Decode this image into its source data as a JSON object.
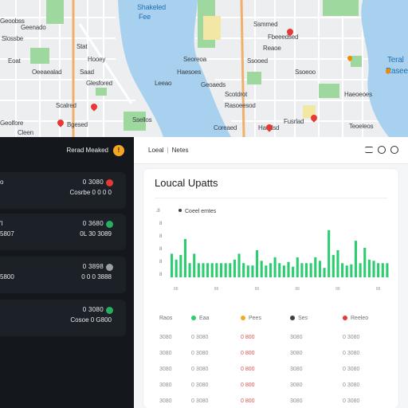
{
  "colors": {
    "water": "#a8d1f0",
    "park": "#9fd89f",
    "road_major": "#f0b06a",
    "sidebar_bg": "#14171c",
    "card_bg": "#1c2027",
    "badge": "#f5a623",
    "bar": "#2ecc71",
    "status_red": "#e53935",
    "status_green": "#27ae60"
  },
  "map": {
    "labels": [
      {
        "text": "Shakeled",
        "kind": "water"
      },
      {
        "text": "Fee",
        "kind": "water"
      },
      {
        "text": "Geenado",
        "kind": "street"
      },
      {
        "text": "Slossbe",
        "kind": "street"
      },
      {
        "text": "Stat",
        "kind": "street"
      },
      {
        "text": "Hooey",
        "kind": "street"
      },
      {
        "text": "Eoat",
        "kind": "street"
      },
      {
        "text": "Oeeaealad",
        "kind": "street"
      },
      {
        "text": "Glesfored",
        "kind": "street"
      },
      {
        "text": "Scalred",
        "kind": "street"
      },
      {
        "text": "Bgesed",
        "kind": "street"
      },
      {
        "text": "Geolfore",
        "kind": "street"
      },
      {
        "text": "Cleen",
        "kind": "street"
      },
      {
        "text": "Ssellos",
        "kind": "street"
      },
      {
        "text": "Seoreoa",
        "kind": "street"
      },
      {
        "text": "Leeao",
        "kind": "street"
      },
      {
        "text": "Haesoes",
        "kind": "street"
      },
      {
        "text": "Geoaeds",
        "kind": "street"
      },
      {
        "text": "Scotdrot",
        "kind": "street"
      },
      {
        "text": "Rasoeesod",
        "kind": "street"
      },
      {
        "text": "Coreaed",
        "kind": "street"
      },
      {
        "text": "Teral",
        "kind": "water"
      },
      {
        "text": "Rasee",
        "kind": "water"
      },
      {
        "text": "Haeoeoes",
        "kind": "street"
      },
      {
        "text": "Teoeleos",
        "kind": "street"
      },
      {
        "text": "Ssmmed",
        "kind": "street"
      },
      {
        "text": "Fbeeedsed",
        "kind": "street"
      },
      {
        "text": "Reaoe",
        "kind": "street"
      },
      {
        "text": "Ssooed",
        "kind": "street"
      },
      {
        "text": "Fusrlad",
        "kind": "street"
      },
      {
        "text": "Haedsd",
        "kind": "street"
      },
      {
        "text": "Geoobss",
        "kind": "street"
      },
      {
        "text": "Ssoeoo",
        "kind": "street"
      },
      {
        "text": "Saad",
        "kind": "street"
      }
    ]
  },
  "sidebar": {
    "title": "Rerad Meaked",
    "badge_icon": "alert-icon",
    "cards": [
      {
        "left1": "o",
        "left2": "",
        "right1": "0 3080",
        "right2": "Cosrbe 0 0 0 0",
        "dot": "#e53935"
      },
      {
        "left1": "'l",
        "left2": "5807",
        "right1": "0 3680",
        "right2": "0L 30 3089",
        "dot": "#27ae60"
      },
      {
        "left1": "",
        "left2": "5800",
        "right1": "0 3898",
        "right2": "0 0 0 3888",
        "dot": "#9aa0a6"
      },
      {
        "left1": "",
        "left2": "",
        "right1": "0 3080",
        "right2": "Cosoe 0 G800",
        "dot": "#27ae60"
      }
    ]
  },
  "main": {
    "header_title": "Loeal",
    "header_subtitle": "Netes",
    "header_icons": [
      "grid-icon",
      "info-icon",
      "settings-icon"
    ],
    "panel_title": "Loucal Upatts"
  },
  "chart_data": {
    "type": "bar",
    "legend": "Coeel emtes",
    "y_ticks": [
      "18",
      "8",
      "8",
      "8",
      "8",
      "8"
    ],
    "ylim": [
      0,
      100
    ],
    "x_ticks": [
      "88",
      "88",
      "88",
      "88",
      "88",
      "88"
    ],
    "values": [
      40,
      30,
      38,
      65,
      24,
      40,
      24,
      24,
      24,
      24,
      24,
      24,
      24,
      24,
      30,
      40,
      24,
      20,
      20,
      46,
      28,
      20,
      24,
      34,
      24,
      20,
      26,
      18,
      34,
      24,
      24,
      24,
      34,
      28,
      16,
      80,
      38,
      46,
      24,
      20,
      22,
      62,
      24,
      50,
      30,
      28,
      24,
      24,
      24
    ]
  },
  "table": {
    "headers": [
      {
        "text": "Raos",
        "dot": ""
      },
      {
        "text": "Eaa",
        "dot": "#2ecc71"
      },
      {
        "text": "Pees",
        "dot": "#f5a623"
      },
      {
        "text": "Ses",
        "dot": "#3a3f45"
      },
      {
        "text": "Reeleo",
        "dot": "#e53935"
      }
    ],
    "rows": [
      [
        "3080",
        "0 3080",
        "0 800",
        "3080",
        "0 3080"
      ],
      [
        "3080",
        "0 3080",
        "0 800",
        "3080",
        "0 3080"
      ],
      [
        "3080",
        "0 3080",
        "0 800",
        "3080",
        "0 3080"
      ],
      [
        "3080",
        "0 3080",
        "0 800",
        "3080",
        "0 3080"
      ],
      [
        "3080",
        "0 3080",
        "0 800",
        "3080",
        "0 3080"
      ],
      [
        "3080",
        "0 3080",
        "0 800",
        "3080",
        "0 3080"
      ]
    ]
  }
}
